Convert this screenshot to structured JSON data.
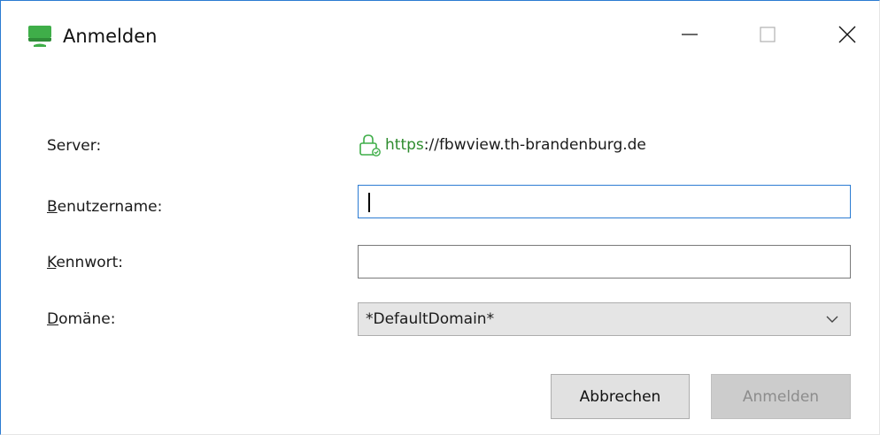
{
  "window": {
    "title": "Anmelden",
    "accent_color": "#2b7bd1"
  },
  "icons": {
    "app": "monitor-icon",
    "lock": "lock-icon",
    "minimize": "minimize-icon",
    "maximize": "maximize-icon",
    "close": "close-icon",
    "dropdown": "chevron-down-icon"
  },
  "form": {
    "server_label": "Server:",
    "server_scheme": "https",
    "server_rest": "://fbwview.th-brandenburg.de",
    "username_label_first": "B",
    "username_label_rest": "enutzername:",
    "username_value": "",
    "password_label_first": "K",
    "password_label_rest": "ennwort:",
    "password_value": "",
    "domain_label_first": "D",
    "domain_label_rest": "omäne:",
    "domain_selected": "*DefaultDomain*"
  },
  "buttons": {
    "cancel_label": "Abbrechen",
    "login_label": "Anmelden"
  }
}
